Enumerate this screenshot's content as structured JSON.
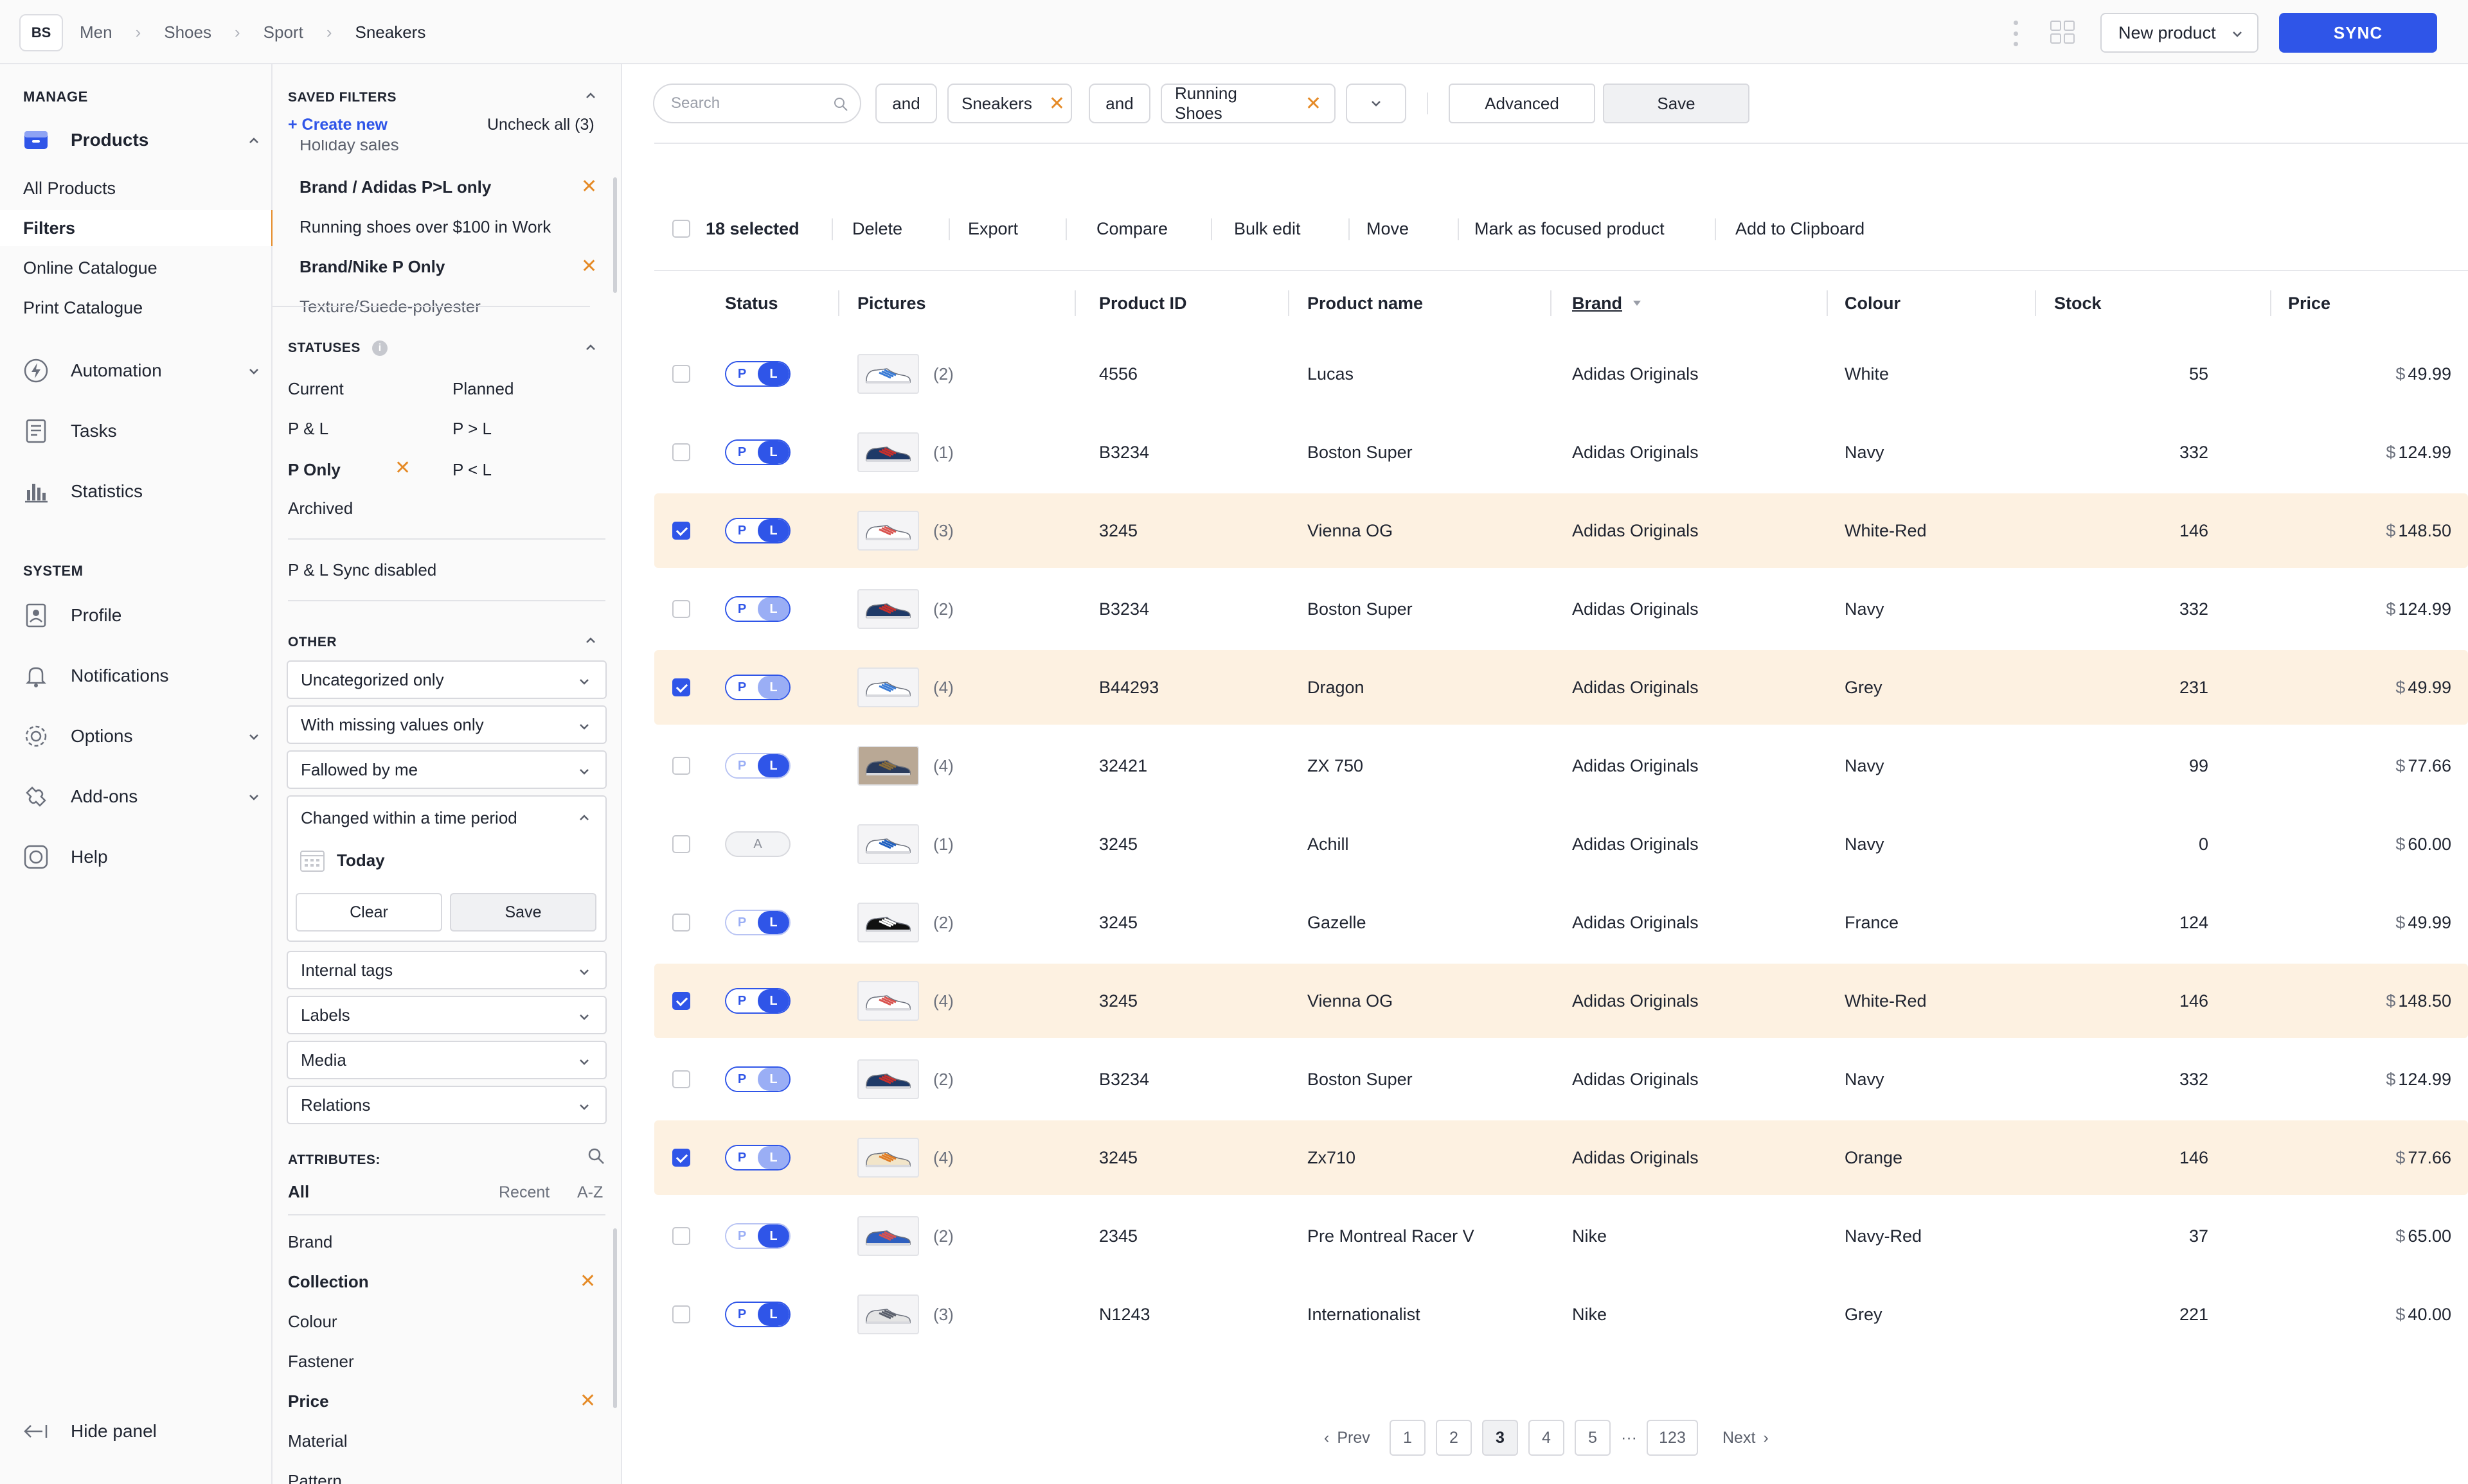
{
  "header": {
    "logo": "BS",
    "breadcrumbs": [
      "Men",
      "Shoes",
      "Sport",
      "Sneakers"
    ],
    "new_product_label": "New product",
    "sync_label": "SYNC"
  },
  "nav": {
    "manage_label": "MANAGE",
    "products_label": "Products",
    "sub_items": [
      "All Products",
      "Filters",
      "Online Catalogue",
      "Print Catalogue"
    ],
    "automation_label": "Automation",
    "tasks_label": "Tasks",
    "statistics_label": "Statistics",
    "system_label": "SYSTEM",
    "profile_label": "Profile",
    "notifications_label": "Notifications",
    "options_label": "Options",
    "addons_label": "Add-ons",
    "help_label": "Help",
    "hide_panel_label": "Hide panel"
  },
  "filters": {
    "saved_filters_label": "SAVED FILTERS",
    "create_new_label": "+ Create new",
    "uncheck_all_label": "Uncheck all (3)",
    "saved": [
      "Holiday sales",
      "Brand / Adidas P>L only",
      "Running shoes over $100 in Work",
      "Brand/Nike P Only",
      "Texture/Suede-polyester"
    ],
    "statuses_label": "STATUSES",
    "statuses": [
      "Current",
      "Planned",
      "P & L",
      "P > L",
      "P Only",
      "P < L",
      "Archived"
    ],
    "sync_disabled_label": "P & L Sync disabled",
    "other_label": "OTHER",
    "other_dropdowns": [
      "Uncategorized only",
      "With missing values only",
      "Fallowed by me"
    ],
    "time_period_label": "Changed within a time period",
    "today_label": "Today",
    "clear_label": "Clear",
    "save_label": "Save",
    "more_dropdowns": [
      "Internal tags",
      "Labels",
      "Media",
      "Relations"
    ],
    "attributes_label": "ATTRIBUTES:",
    "attr_tab_all": "All",
    "attr_tab_recent": "Recent",
    "attr_tab_az": "A-Z",
    "attributes": [
      "Brand",
      "Collection",
      "Colour",
      "Fastener",
      "Price",
      "Material",
      "Pattern"
    ]
  },
  "toolbar": {
    "search_placeholder": "Search",
    "and_1": "and",
    "chip_1": "Sneakers",
    "and_2": "and",
    "chip_2": "Running Shoes",
    "advanced_label": "Advanced",
    "save_label": "Save"
  },
  "actions": {
    "selected_label": "18 selected",
    "items": [
      "Delete",
      "Export",
      "Compare",
      "Bulk edit",
      "Move",
      "Mark as focused product",
      "Add to Clipboard"
    ]
  },
  "table": {
    "columns": [
      "Status",
      "Pictures",
      "Product ID",
      "Product name",
      "Brand",
      "Colour",
      "Stock",
      "Price"
    ],
    "currency": "$",
    "rows": [
      {
        "selected": false,
        "status": "pl",
        "count": "(2)",
        "id": "4556",
        "name": "Lucas",
        "brand": "Adidas Originals",
        "colour": "White",
        "stock": "55",
        "price": "49.99"
      },
      {
        "selected": false,
        "status": "pl",
        "count": "(1)",
        "id": "B3234",
        "name": "Boston Super",
        "brand": "Adidas Originals",
        "colour": "Navy",
        "stock": "332",
        "price": "124.99"
      },
      {
        "selected": true,
        "status": "pl",
        "count": "(3)",
        "id": "3245",
        "name": "Vienna OG",
        "brand": "Adidas Originals",
        "colour": "White-Red",
        "stock": "146",
        "price": "148.50"
      },
      {
        "selected": false,
        "status": "lfaded",
        "count": "(2)",
        "id": "B3234",
        "name": "Boston Super",
        "brand": "Adidas Originals",
        "colour": "Navy",
        "stock": "332",
        "price": "124.99"
      },
      {
        "selected": true,
        "status": "lfaded",
        "count": "(4)",
        "id": "B44293",
        "name": "Dragon",
        "brand": "Adidas Originals",
        "colour": "Grey",
        "stock": "231",
        "price": "49.99"
      },
      {
        "selected": false,
        "status": "pfaded",
        "count": "(4)",
        "id": "32421",
        "name": "ZX 750",
        "brand": "Adidas Originals",
        "colour": "Navy",
        "stock": "99",
        "price": "77.66"
      },
      {
        "selected": false,
        "status": "archived",
        "count": "(1)",
        "id": "3245",
        "name": "Achill",
        "brand": "Adidas Originals",
        "colour": "Navy",
        "stock": "0",
        "price": "60.00"
      },
      {
        "selected": false,
        "status": "pfaded",
        "count": "(2)",
        "id": "3245",
        "name": "Gazelle",
        "brand": "Adidas Originals",
        "colour": "France",
        "stock": "124",
        "price": "49.99"
      },
      {
        "selected": true,
        "status": "pl",
        "count": "(4)",
        "id": "3245",
        "name": "Vienna OG",
        "brand": "Adidas Originals",
        "colour": "White-Red",
        "stock": "146",
        "price": "148.50"
      },
      {
        "selected": false,
        "status": "lfaded",
        "count": "(2)",
        "id": "B3234",
        "name": "Boston Super",
        "brand": "Adidas Originals",
        "colour": "Navy",
        "stock": "332",
        "price": "124.99"
      },
      {
        "selected": true,
        "status": "lfaded",
        "count": "(4)",
        "id": "3245",
        "name": "Zx710",
        "brand": "Adidas Originals",
        "colour": "Orange",
        "stock": "146",
        "price": "77.66"
      },
      {
        "selected": false,
        "status": "pfaded",
        "count": "(2)",
        "id": "2345",
        "name": "Pre Montreal Racer V",
        "brand": "Nike",
        "colour": "Navy-Red",
        "stock": "37",
        "price": "65.00"
      },
      {
        "selected": false,
        "status": "pl",
        "count": "(3)",
        "id": "N1243",
        "name": "Internationalist",
        "brand": "Nike",
        "colour": "Grey",
        "stock": "221",
        "price": "40.00"
      }
    ]
  },
  "pagination": {
    "prev_label": "Prev",
    "next_label": "Next",
    "pages": [
      "1",
      "2",
      "3",
      "4",
      "5"
    ],
    "ellipsis": "···",
    "last_page": "123",
    "current": "3"
  },
  "colors": {
    "accent": "#2f55e8",
    "highlight_row": "#fdf1e1",
    "remove_x": "#e58a26"
  }
}
